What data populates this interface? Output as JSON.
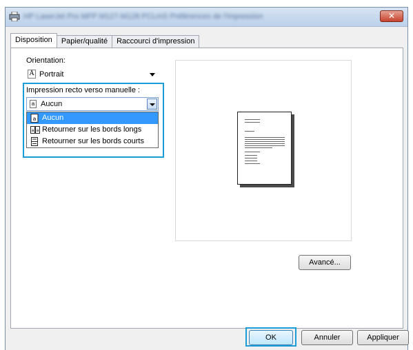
{
  "window": {
    "title": "HP LaserJet Pro MFP M127-M128 PCLmS Préférences de l'impression",
    "close_label": "✕"
  },
  "tabs": [
    {
      "label": "Disposition",
      "active": true
    },
    {
      "label": "Papier/qualité",
      "active": false
    },
    {
      "label": "Raccourci d'impression",
      "active": false
    }
  ],
  "orientation": {
    "label": "Orientation:",
    "value": "Portrait",
    "icon": "letter-a-icon"
  },
  "duplex": {
    "label": "Impression recto verso manuelle :",
    "value": "Aucun",
    "options": [
      {
        "label": "Aucun",
        "selected": true,
        "icon": "single-page-icon"
      },
      {
        "label": "Retourner sur les bords longs",
        "selected": false,
        "icon": "book-long-edge-icon"
      },
      {
        "label": "Retourner sur les bords courts",
        "selected": false,
        "icon": "book-short-edge-icon"
      }
    ]
  },
  "preview": {
    "icon": "document-page-icon"
  },
  "buttons": {
    "advanced": "Avancé...",
    "ok": "OK",
    "cancel": "Annuler",
    "apply": "Appliquer"
  },
  "colors": {
    "highlight": "#1a9cd8",
    "selection": "#3399ff",
    "close": "#c5432c"
  }
}
